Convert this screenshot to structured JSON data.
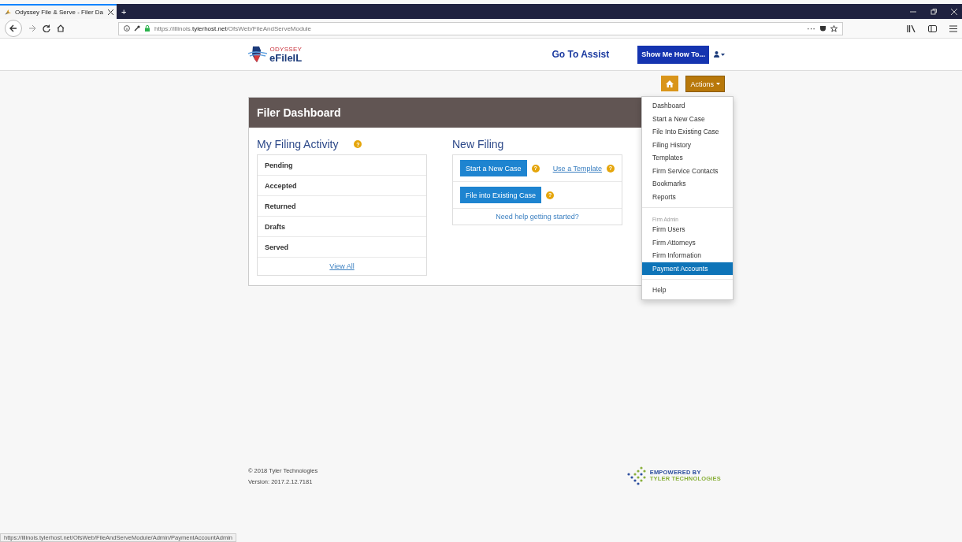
{
  "browser": {
    "tab_title": "Odyssey File & Serve - Filer Da",
    "new_tab": "+",
    "url_prefix": "https://illinois.",
    "url_domain": "tylerhost.net",
    "url_path": "/OfsWeb/FileAndServeModule",
    "more": "···"
  },
  "header": {
    "logo_top": "ODYSSEY",
    "logo_main": "eFileIL",
    "assist_link": "Go To Assist",
    "help_button": "Show Me How To..."
  },
  "toolbar": {
    "actions_button": "Actions"
  },
  "dashboard": {
    "title": "Filer Dashboard",
    "activity": {
      "heading": "My Filing Activity",
      "help": "?",
      "rows": [
        "Pending",
        "Accepted",
        "Returned",
        "Drafts",
        "Served"
      ],
      "view_all": "View All"
    },
    "new_filing": {
      "heading": "New Filing",
      "start_button": "Start a New Case",
      "start_help": "?",
      "template_link": "Use a Template",
      "template_help": "?",
      "existing_button": "File into Existing Case",
      "existing_help": "?",
      "help_link": "Need help getting started?"
    }
  },
  "actions_menu": {
    "expanded": true,
    "items": [
      {
        "kind": "item",
        "label": "Dashboard",
        "selected": false
      },
      {
        "kind": "item",
        "label": "Start a New Case",
        "selected": false
      },
      {
        "kind": "item",
        "label": "File Into Existing Case",
        "selected": false
      },
      {
        "kind": "item",
        "label": "Filing History",
        "selected": false
      },
      {
        "kind": "item",
        "label": "Templates",
        "selected": false
      },
      {
        "kind": "item",
        "label": "Firm Service Contacts",
        "selected": false
      },
      {
        "kind": "item",
        "label": "Bookmarks",
        "selected": false
      },
      {
        "kind": "item",
        "label": "Reports",
        "selected": false
      },
      {
        "kind": "divider"
      },
      {
        "kind": "header",
        "label": "Firm Admin"
      },
      {
        "kind": "item",
        "label": "Firm Users",
        "selected": false
      },
      {
        "kind": "item",
        "label": "Firm Attorneys",
        "selected": false
      },
      {
        "kind": "item",
        "label": "Firm Information",
        "selected": false
      },
      {
        "kind": "item",
        "label": "Payment Accounts",
        "selected": true
      },
      {
        "kind": "divider"
      },
      {
        "kind": "item",
        "label": "Help",
        "selected": false
      }
    ]
  },
  "footer": {
    "copyright": "© 2018 Tyler Technologies",
    "version": "Version: 2017.2.12.7181",
    "brand_top": "EMPOWERED BY",
    "brand_bottom": "TYLER TECHNOLOGIES"
  },
  "status_bar": "https://illinois.tylerhost.net/OfsWeb/FileAndServeModule/Admin/PaymentAccountAdmin"
}
